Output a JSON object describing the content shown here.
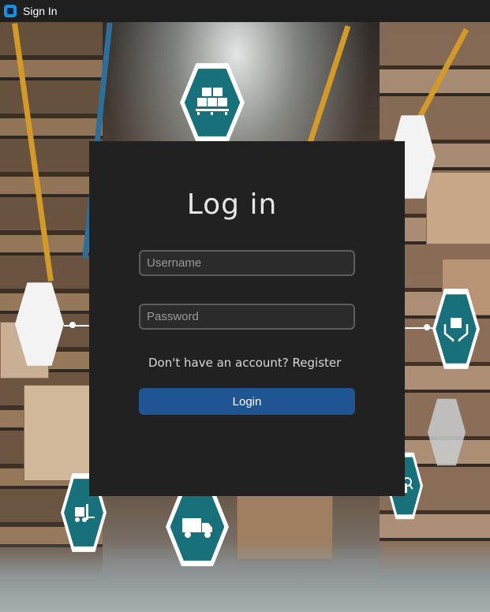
{
  "window": {
    "title": "Sign In",
    "icon": "app-icon"
  },
  "login": {
    "heading": "Log in",
    "username_placeholder": "Username",
    "username_value": "",
    "password_placeholder": "Password",
    "password_value": "",
    "register_prompt": "Don't have an account? ",
    "register_link": "Register",
    "login_button": "Login"
  },
  "colors": {
    "card_background": "#212121",
    "button": "#1f5593",
    "hex_teal": "#17707a",
    "title_bar": "#1f1f1f"
  },
  "background_icons": [
    "boxes-on-pallet-icon",
    "hands-holding-box-icon",
    "forklift-icon",
    "delivery-truck-icon",
    "magnifier-box-icon"
  ]
}
